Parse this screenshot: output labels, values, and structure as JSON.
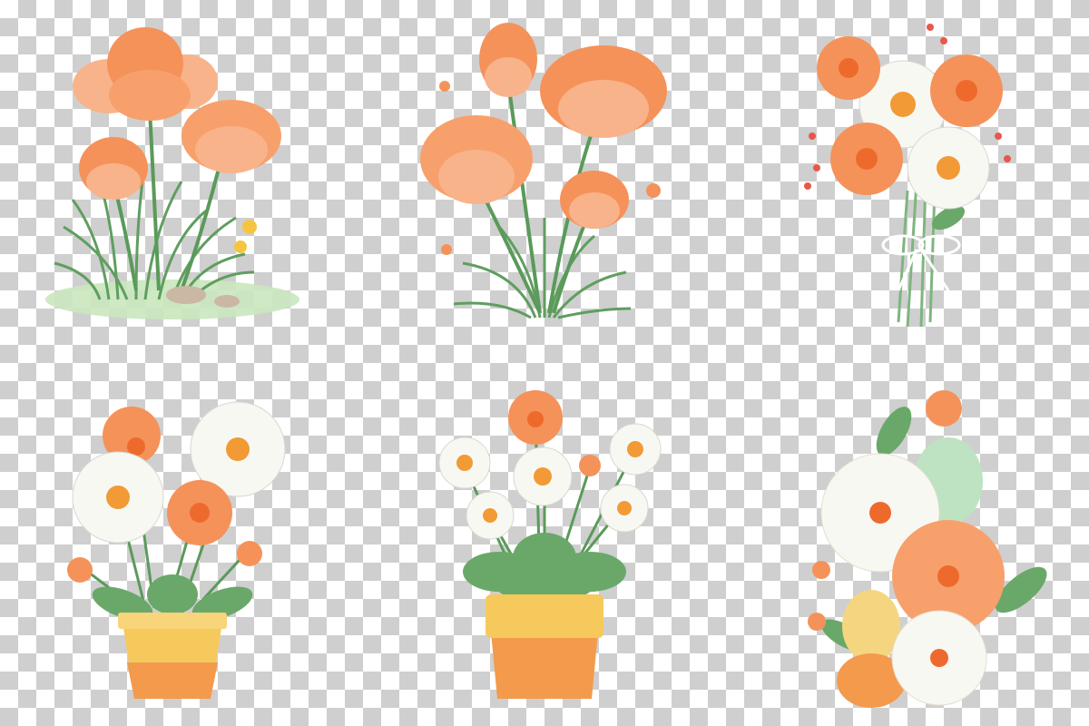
{
  "image": {
    "background": "transparency-checkerboard",
    "layout": "grid-3x2",
    "illustrations": [
      {
        "name": "tulips-on-grass"
      },
      {
        "name": "tulip-bunch"
      },
      {
        "name": "daisy-bouquet-with-ribbon"
      },
      {
        "name": "daisies-in-yellow-pot"
      },
      {
        "name": "daisies-in-orange-pot"
      },
      {
        "name": "blossoms-with-easter-eggs"
      }
    ]
  },
  "colors": {
    "petal_orange": "#f5925a",
    "petal_peach": "#f8b38a",
    "deep_orange": "#ee6a2c",
    "daisy_white": "#f8f8f3",
    "daisy_center": "#f29a35",
    "leaf_green": "#6aa86a",
    "grass_green": "#8cc17e",
    "pot_yellow": "#f6c95c",
    "pot_orange": "#f39a4c",
    "egg_mint": "#bde3c2",
    "egg_yellow": "#f5d680",
    "ground_green": "#c9e7be"
  }
}
